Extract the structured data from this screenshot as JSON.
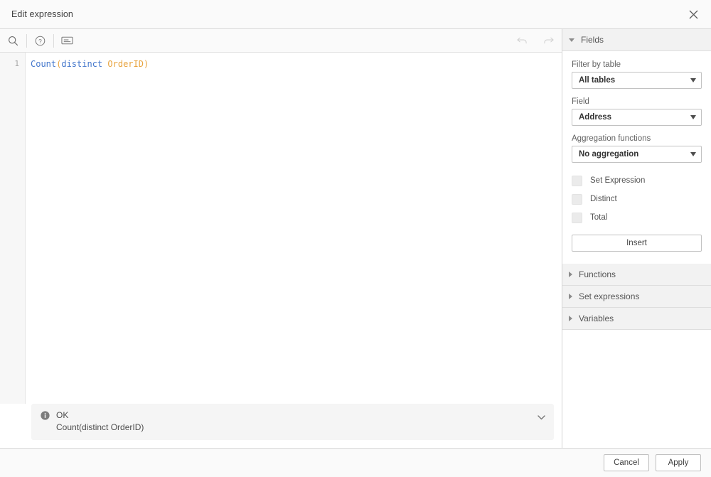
{
  "dialog": {
    "title": "Edit expression",
    "close_icon": "close-icon"
  },
  "toolbar": {
    "search_icon": "search-icon",
    "help_icon": "help-circle-icon",
    "snippet_icon": "snippet-card-icon",
    "undo_icon": "undo-arrow-icon",
    "redo_icon": "redo-arrow-icon"
  },
  "editor": {
    "line_number": "1",
    "tokens": {
      "func": "Count",
      "open_paren": "(",
      "keyword": "distinct",
      "space": " ",
      "field": "OrderID",
      "close_paren": ")"
    },
    "colors": {
      "function": "#4477cc",
      "keyword": "#4477cc",
      "field": "#e8a33d",
      "paren": "#e8a33d"
    }
  },
  "status": {
    "info_icon": "info-circle-icon",
    "label": "OK",
    "expression": "Count(distinct OrderID)",
    "expand_icon": "chevron-down-icon"
  },
  "panel": {
    "fields_section": {
      "label": "Fields",
      "expanded": true,
      "caret_icon": "caret-down-icon",
      "filter_by_table_label": "Filter by table",
      "filter_by_table_value": "All tables",
      "field_label": "Field",
      "field_value": "Address",
      "aggregation_label": "Aggregation functions",
      "aggregation_value": "No aggregation",
      "checkboxes": [
        {
          "label": "Set Expression",
          "checked": false
        },
        {
          "label": "Distinct",
          "checked": false
        },
        {
          "label": "Total",
          "checked": false
        }
      ],
      "insert_label": "Insert"
    },
    "collapsed_sections": [
      {
        "label": "Functions",
        "caret_icon": "caret-right-icon"
      },
      {
        "label": "Set expressions",
        "caret_icon": "caret-right-icon"
      },
      {
        "label": "Variables",
        "caret_icon": "caret-right-icon"
      }
    ]
  },
  "footer": {
    "cancel_label": "Cancel",
    "apply_label": "Apply"
  }
}
